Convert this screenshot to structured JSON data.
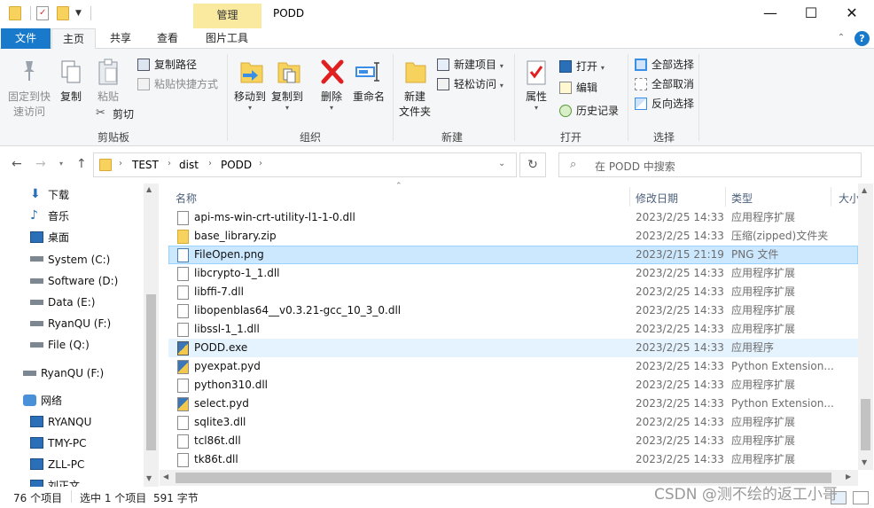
{
  "window": {
    "context_tab": "管理",
    "title": "PODD",
    "minimize_glyph": "—",
    "maximize_glyph": "☐",
    "close_glyph": "✕"
  },
  "ribbon_tabs": [
    {
      "label": "文件"
    },
    {
      "label": "主页"
    },
    {
      "label": "共享"
    },
    {
      "label": "查看"
    },
    {
      "label": "图片工具"
    }
  ],
  "ribbon": {
    "clipboard": {
      "pin_label_1": "固定到快",
      "pin_label_2": "速访问",
      "copy_label": "复制",
      "paste_label": "粘贴",
      "copy_path_label": "复制路径",
      "paste_shortcut_label": "粘贴快捷方式",
      "cut_label": "剪切",
      "group_label": "剪贴板"
    },
    "organize": {
      "move_to_label": "移动到",
      "copy_to_label": "复制到",
      "delete_label": "删除",
      "rename_label": "重命名",
      "group_label": "组织"
    },
    "new": {
      "new_folder_label_1": "新建",
      "new_folder_label_2": "文件夹",
      "new_item_label": "新建项目",
      "easy_access_label": "轻松访问",
      "group_label": "新建"
    },
    "open": {
      "properties_label": "属性",
      "open_label": "打开",
      "edit_label": "编辑",
      "history_label": "历史记录",
      "group_label": "打开"
    },
    "select": {
      "select_all_label": "全部选择",
      "select_none_label": "全部取消",
      "invert_label": "反向选择",
      "group_label": "选择"
    }
  },
  "breadcrumb": [
    "TEST",
    "dist",
    "PODD"
  ],
  "search": {
    "placeholder": "在 PODD 中搜索"
  },
  "sidebar": {
    "items": [
      {
        "label": "下载",
        "icon": "download-icon"
      },
      {
        "label": "音乐",
        "icon": "music-icon"
      },
      {
        "label": "桌面",
        "icon": "desktop-icon"
      },
      {
        "label": "System (C:)",
        "icon": "drive-icon"
      },
      {
        "label": "Software (D:)",
        "icon": "drive-icon"
      },
      {
        "label": "Data (E:)",
        "icon": "drive-icon"
      },
      {
        "label": "RyanQU (F:)",
        "icon": "drive-icon"
      },
      {
        "label": "File (Q:)",
        "icon": "drive-icon"
      },
      {
        "label": "RyanQU (F:)",
        "icon": "drive-icon"
      },
      {
        "label": "网络",
        "icon": "network-icon"
      },
      {
        "label": "RYANQU",
        "icon": "computer-icon"
      },
      {
        "label": "TMY-PC",
        "icon": "computer-icon"
      },
      {
        "label": "ZLL-PC",
        "icon": "computer-icon"
      },
      {
        "label": "刘正文",
        "icon": "computer-icon"
      }
    ]
  },
  "columns": {
    "name": "名称",
    "modified": "修改日期",
    "type": "类型",
    "size": "大小"
  },
  "files": [
    {
      "name": "api-ms-win-crt-utility-l1-1-0.dll",
      "date": "2023/2/25 14:33",
      "type": "应用程序扩展",
      "icon": "dll-icon"
    },
    {
      "name": "base_library.zip",
      "date": "2023/2/25 14:33",
      "type": "压缩(zipped)文件夹",
      "icon": "zip-icon"
    },
    {
      "name": "FileOpen.png",
      "date": "2023/2/15 21:19",
      "type": "PNG 文件",
      "icon": "image-icon"
    },
    {
      "name": "libcrypto-1_1.dll",
      "date": "2023/2/25 14:33",
      "type": "应用程序扩展",
      "icon": "dll-icon"
    },
    {
      "name": "libffi-7.dll",
      "date": "2023/2/25 14:33",
      "type": "应用程序扩展",
      "icon": "dll-icon"
    },
    {
      "name": "libopenblas64__v0.3.21-gcc_10_3_0.dll",
      "date": "2023/2/25 14:33",
      "type": "应用程序扩展",
      "icon": "dll-icon"
    },
    {
      "name": "libssl-1_1.dll",
      "date": "2023/2/25 14:33",
      "type": "应用程序扩展",
      "icon": "dll-icon"
    },
    {
      "name": "PODD.exe",
      "date": "2023/2/25 14:33",
      "type": "应用程序",
      "icon": "exe-icon"
    },
    {
      "name": "pyexpat.pyd",
      "date": "2023/2/25 14:33",
      "type": "Python Extension...",
      "icon": "python-icon"
    },
    {
      "name": "python310.dll",
      "date": "2023/2/25 14:33",
      "type": "应用程序扩展",
      "icon": "dll-icon"
    },
    {
      "name": "select.pyd",
      "date": "2023/2/25 14:33",
      "type": "Python Extension...",
      "icon": "python-icon"
    },
    {
      "name": "sqlite3.dll",
      "date": "2023/2/25 14:33",
      "type": "应用程序扩展",
      "icon": "dll-icon"
    },
    {
      "name": "tcl86t.dll",
      "date": "2023/2/25 14:33",
      "type": "应用程序扩展",
      "icon": "dll-icon"
    },
    {
      "name": "tk86t.dll",
      "date": "2023/2/25 14:33",
      "type": "应用程序扩展",
      "icon": "dll-icon"
    }
  ],
  "status": {
    "item_count": "76 个项目",
    "selection": "选中 1 个项目",
    "selection_size": "591 字节"
  },
  "watermark": "CSDN @测不绘的返工小哥"
}
